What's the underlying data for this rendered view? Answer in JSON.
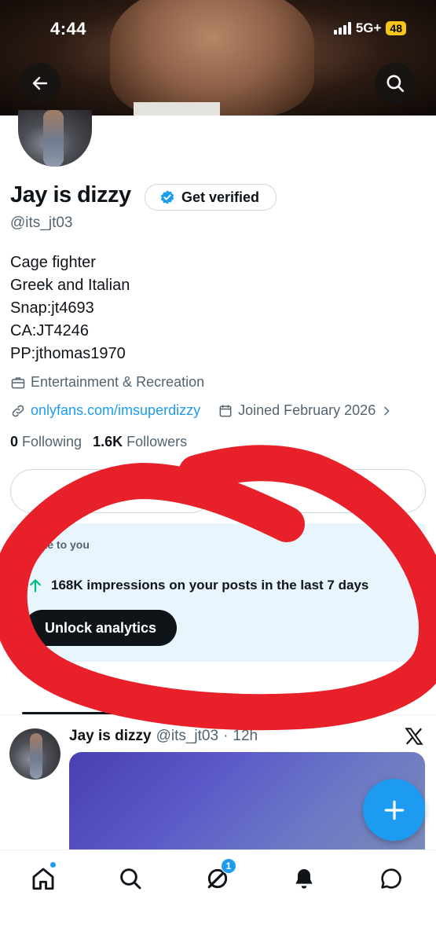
{
  "status_bar": {
    "time": "4:44",
    "network": "5G+",
    "battery": "48"
  },
  "profile": {
    "name": "Jay is dizzy",
    "verify_label": "Get verified",
    "handle": "@its_jt03",
    "bio_lines": [
      "Cage fighter",
      "Greek and Italian",
      "Snap:jt4693",
      "CA:JT4246",
      "PP:jthomas1970"
    ],
    "category": "Entertainment & Recreation",
    "link": "onlyfans.com/imsuperdizzy",
    "joined": "Joined February 2026",
    "following_count": "0",
    "following_label": "Following",
    "followers_count": "1.6K",
    "followers_label": "Followers"
  },
  "analytics": {
    "private_label": "vate to you",
    "impressions_text": "168K impressions on your posts in the last 7 days",
    "unlock_label": "Unlock analytics"
  },
  "post": {
    "author": "Jay is dizzy",
    "handle": "@its_jt03",
    "separator": "·",
    "time": "12h"
  },
  "nav": {
    "messages_badge": "1"
  },
  "colors": {
    "accent": "#1d9bf0",
    "annotation": "#e8202a",
    "analytics_bg": "#e8f5fd"
  }
}
